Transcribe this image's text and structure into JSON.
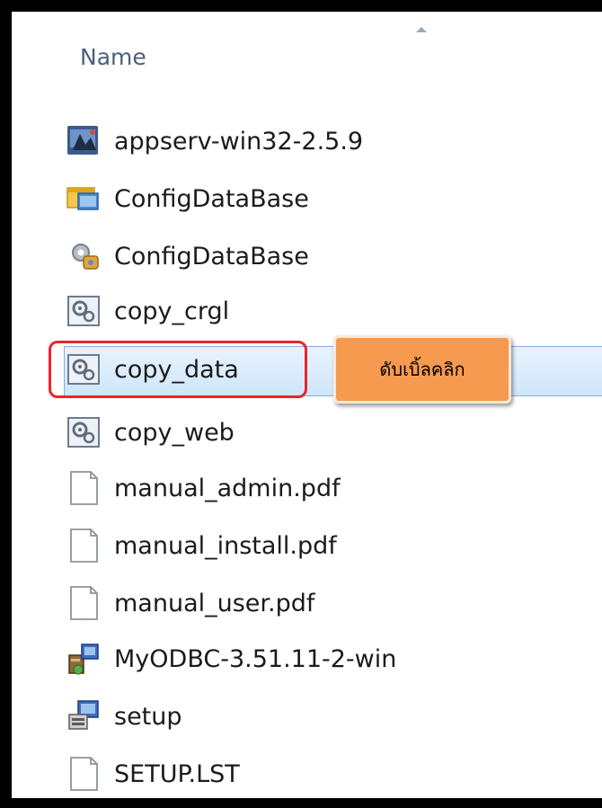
{
  "explorer": {
    "column_header": "Name",
    "files": [
      {
        "name": "appserv-win32-2.5.9",
        "icon": "installer-icon"
      },
      {
        "name": "ConfigDataBase",
        "icon": "app-window-icon"
      },
      {
        "name": "ConfigDataBase",
        "icon": "config-gear-icon"
      },
      {
        "name": "copy_crgl",
        "icon": "batch-file-icon"
      },
      {
        "name": "copy_data",
        "icon": "batch-file-icon",
        "selected": true
      },
      {
        "name": "copy_web",
        "icon": "batch-file-icon"
      },
      {
        "name": "manual_admin.pdf",
        "icon": "blank-document-icon"
      },
      {
        "name": "manual_install.pdf",
        "icon": "blank-document-icon"
      },
      {
        "name": "manual_user.pdf",
        "icon": "blank-document-icon"
      },
      {
        "name": "MyODBC-3.51.11-2-win",
        "icon": "setup-package-icon"
      },
      {
        "name": "setup",
        "icon": "setup-computer-icon"
      },
      {
        "name": "SETUP.LST",
        "icon": "blank-document-icon"
      }
    ]
  },
  "annotation": {
    "callout_text": "ดับเบิ้ลคลิก"
  },
  "colors": {
    "selection": "#cfe6fb",
    "highlight_border": "#e8262b",
    "callout_bg": "#f59a4e"
  }
}
